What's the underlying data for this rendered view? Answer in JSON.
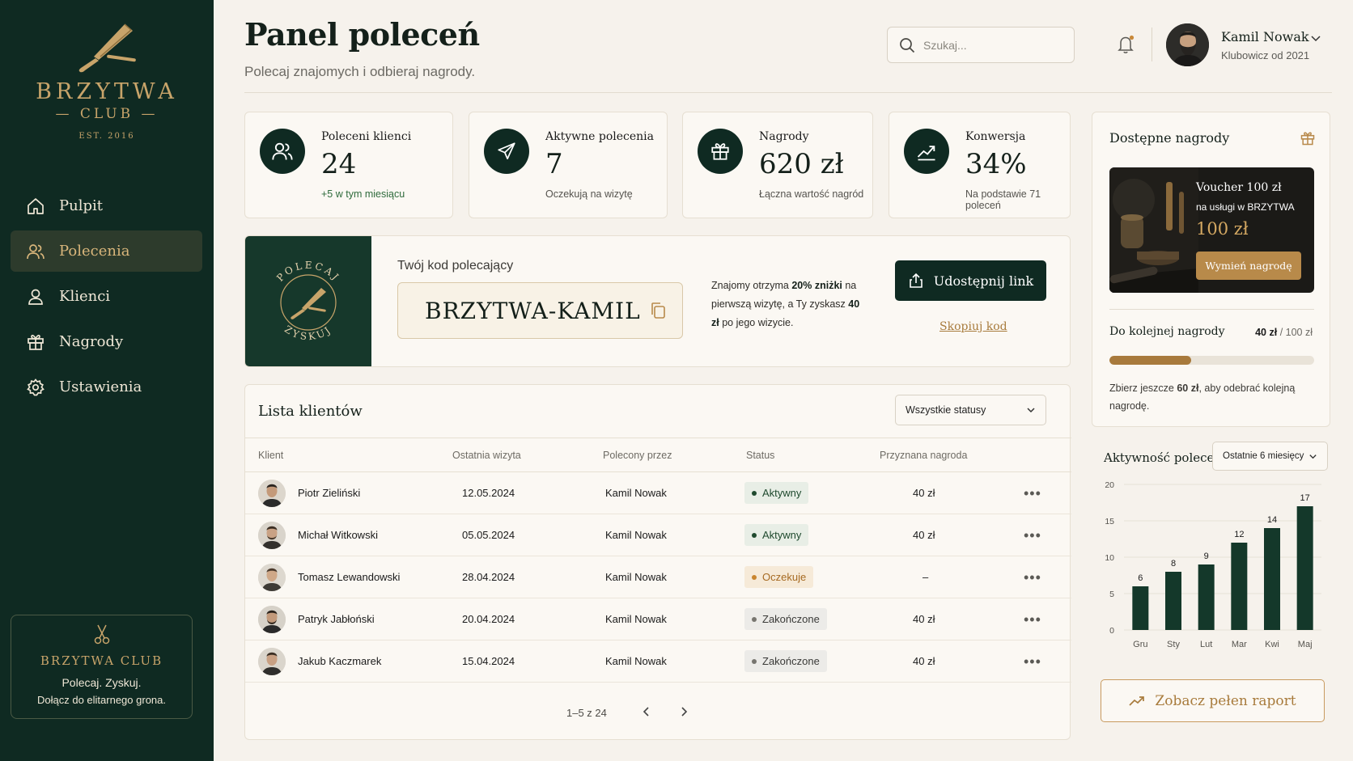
{
  "brand": {
    "name": "BRZYTWA",
    "sub": "CLUB",
    "est": "EST. 2016"
  },
  "nav": [
    {
      "label": "Pulpit",
      "icon": "home-icon",
      "active": false
    },
    {
      "label": "Polecenia",
      "icon": "users-icon",
      "active": true
    },
    {
      "label": "Klienci",
      "icon": "user-icon",
      "active": false
    },
    {
      "label": "Nagrody",
      "icon": "gift-icon",
      "active": false
    },
    {
      "label": "Ustawienia",
      "icon": "gear-icon",
      "active": false
    }
  ],
  "promo": {
    "title": "BRZYTWA CLUB",
    "line1": "Polecaj. Zyskuj.",
    "line2": "Dołącz do elitarnego grona."
  },
  "header": {
    "title": "Panel poleceń",
    "subtitle": "Polecaj znajomych i odbieraj nagrody."
  },
  "search": {
    "placeholder": "Szukaj..."
  },
  "user": {
    "name": "Kamil Nowak",
    "since": "Klubowicz od 2021"
  },
  "stats": [
    {
      "label": "Poleceni klienci",
      "value": "24",
      "note": "+5 w tym miesiącu"
    },
    {
      "label": "Aktywne polecenia",
      "value": "7",
      "note": "Oczekują na wizytę"
    },
    {
      "label": "Nagrody",
      "value": "620 zł",
      "note": "Łączna wartość nagród"
    },
    {
      "label": "Konwersja",
      "value": "34%",
      "note": "Na podstawie 71 poleceń"
    }
  ],
  "referral": {
    "badge_top": "POLECAJ",
    "badge_bottom": "ZYSKUJ",
    "label": "Twój kod polecający",
    "code": "BRZYTWA-KAMIL",
    "desc_1": "Znajomy otrzyma ",
    "desc_b1": "20% zniżki",
    "desc_2": " na pierwszą wizytę, a Ty zyskasz ",
    "desc_b2": "40 zł",
    "desc_3": " po jego wizycie.",
    "share_label": "Udostępnij link",
    "copy_label": "Skopiuj kod"
  },
  "clients": {
    "title": "Lista klientów",
    "filter": "Wszystkie statusy",
    "columns": [
      "Klient",
      "Ostatnia wizyta",
      "Polecony przez",
      "Status",
      "Przyznana nagroda"
    ],
    "rows": [
      {
        "name": "Piotr Zieliński",
        "date": "12.05.2024",
        "by": "Kamil Nowak",
        "status": "Aktywny",
        "tone": "green",
        "reward": "40 zł"
      },
      {
        "name": "Michał Witkowski",
        "date": "05.05.2024",
        "by": "Kamil Nowak",
        "status": "Aktywny",
        "tone": "green",
        "reward": "40 zł"
      },
      {
        "name": "Tomasz Lewandowski",
        "date": "28.04.2024",
        "by": "Kamil Nowak",
        "status": "Oczekuje",
        "tone": "amber",
        "reward": "–"
      },
      {
        "name": "Patryk Jabłoński",
        "date": "20.04.2024",
        "by": "Kamil Nowak",
        "status": "Zakończone",
        "tone": "gray",
        "reward": "40 zł"
      },
      {
        "name": "Jakub Kaczmarek",
        "date": "15.04.2024",
        "by": "Kamil Nowak",
        "status": "Zakończone",
        "tone": "gray",
        "reward": "40 zł"
      }
    ],
    "pager": "1–5 z 24"
  },
  "rewards": {
    "title": "Dostępne nagrody",
    "voucher_title": "Voucher 100 zł",
    "voucher_sub": "na usługi w BRZYTWA",
    "voucher_amount": "100 zł",
    "voucher_btn": "Wymień nagrodę",
    "next_label": "Do kolejnej nagrody",
    "next_current": "40 zł",
    "next_target": "/ 100 zł",
    "progress": 0.4,
    "note_1": "Zbierz jeszcze ",
    "note_b": "60 zł",
    "note_2": ", aby odebrać kolejną nagrodę."
  },
  "activity": {
    "title": "Aktywność poleceń",
    "range": "Ostatnie 6 miesięcy",
    "report_btn": "Zobacz pełen raport"
  },
  "chart_data": {
    "type": "bar",
    "categories": [
      "Gru",
      "Sty",
      "Lut",
      "Mar",
      "Kwi",
      "Maj"
    ],
    "values": [
      6,
      8,
      9,
      12,
      14,
      17
    ],
    "yticks": [
      0,
      5,
      10,
      15,
      20
    ],
    "ylim": [
      0,
      20
    ],
    "color": "#14382a"
  },
  "colors": {
    "sidebar": "#0f2a22",
    "accent": "#c8a46a",
    "primary": "#0f2a22",
    "background": "#f6f2ec"
  }
}
